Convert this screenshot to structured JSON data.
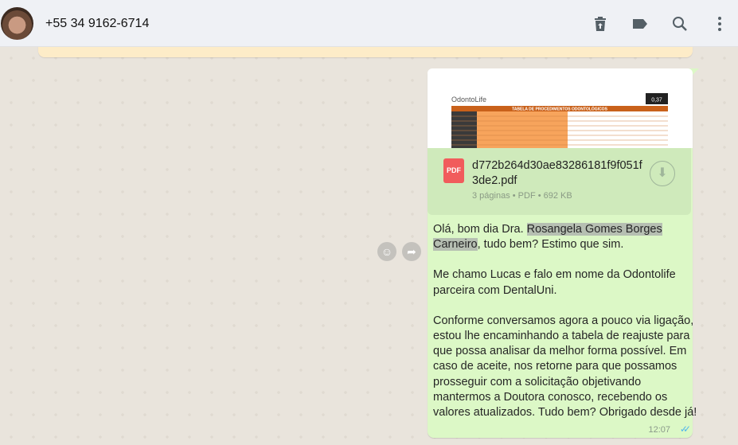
{
  "header": {
    "contact": "+55 34 9162-6714",
    "icons": [
      "archive-delete-icon",
      "label-icon",
      "search-icon",
      "menu-icon"
    ]
  },
  "message": {
    "file": {
      "name": "d772b264d30ae83286181f9f051f3de2.pdf",
      "meta": "3 páginas • PDF • 692 KB",
      "type_label": "PDF"
    },
    "text": {
      "l1a": "Olá, bom dia Dra. ",
      "l1b": "Rosangela Gomes Borges ",
      "l2a": "Carneiro",
      "l2b": ", tudo bem? Estimo que sim.",
      "p2": [
        "Me chamo Lucas e falo em nome da Odontolife",
        "parceira com DentalUni."
      ],
      "p3": [
        "Conforme conversamos agora a pouco via ligação,",
        "estou lhe encaminhando a tabela de reajuste para",
        "que possa analisar da melhor forma possível. Em",
        "caso de aceite, nos retorne para que possamos",
        "prosseguir com a solicitação objetivando",
        "mantermos a Doutora conosco, recebendo os",
        "valores atualizados. Tudo bem? Obrigado desde já!"
      ]
    },
    "time": "12:07",
    "status": "read"
  },
  "thumbnail": {
    "logo": "OdontoLife",
    "table_title": "TABELA DE PROCEDIMENTOS ODONTOLÓGICOS",
    "badge": "0,37"
  },
  "colors": {
    "bubble": "#dcf8c6",
    "ticks": "#4fb6ec",
    "header": "#eff1f5"
  }
}
